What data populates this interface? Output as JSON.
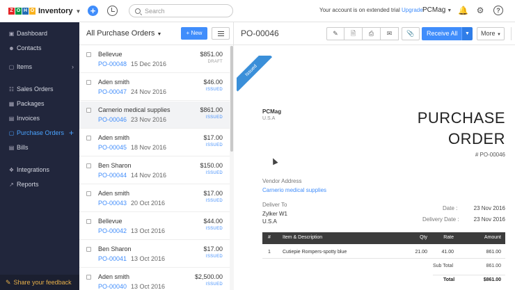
{
  "header": {
    "brand_logo": "ZOHO",
    "brand_name": "Inventory",
    "search_placeholder": "Search",
    "trial_text": "Your account is on extended trial",
    "upgrade_label": "Upgrade",
    "org_name": "PCMag"
  },
  "sidebar": {
    "items": [
      {
        "label": "Dashboard",
        "icon": "dashboard-icon"
      },
      {
        "label": "Contacts",
        "icon": "contacts-icon"
      },
      {
        "label": "Items",
        "icon": "items-icon",
        "chevron": "›"
      },
      {
        "label": "Sales Orders",
        "icon": "sales-orders-icon"
      },
      {
        "label": "Packages",
        "icon": "packages-icon"
      },
      {
        "label": "Invoices",
        "icon": "invoices-icon"
      },
      {
        "label": "Purchase Orders",
        "icon": "purchase-orders-icon",
        "plus": "+"
      },
      {
        "label": "Bills",
        "icon": "bills-icon"
      },
      {
        "label": "Integrations",
        "icon": "integrations-icon"
      },
      {
        "label": "Reports",
        "icon": "reports-icon"
      }
    ],
    "feedback_label": "Share your feedback",
    "accent_color": "#4aa3ff"
  },
  "list": {
    "title": "All Purchase Orders",
    "new_label": "New",
    "rows": [
      {
        "vendor": "Bellevue",
        "po": "PO-00048",
        "date": "15 Dec 2016",
        "amount": "$851.00",
        "status": "DRAFT"
      },
      {
        "vendor": "Aden smith",
        "po": "PO-00047",
        "date": "24 Nov 2016",
        "amount": "$46.00",
        "status": "ISSUED"
      },
      {
        "vendor": "Carnerio medical supplies",
        "po": "PO-00046",
        "date": "23 Nov 2016",
        "amount": "$861.00",
        "status": "ISSUED"
      },
      {
        "vendor": "Aden smith",
        "po": "PO-00045",
        "date": "18 Nov 2016",
        "amount": "$17.00",
        "status": "ISSUED"
      },
      {
        "vendor": "Ben Sharon",
        "po": "PO-00044",
        "date": "14 Nov 2016",
        "amount": "$150.00",
        "status": "ISSUED"
      },
      {
        "vendor": "Aden smith",
        "po": "PO-00043",
        "date": "20 Oct 2016",
        "amount": "$17.00",
        "status": "ISSUED"
      },
      {
        "vendor": "Bellevue",
        "po": "PO-00042",
        "date": "13 Oct 2016",
        "amount": "$44.00",
        "status": "ISSUED"
      },
      {
        "vendor": "Ben Sharon",
        "po": "PO-00041",
        "date": "13 Oct 2016",
        "amount": "$17.00",
        "status": "ISSUED"
      },
      {
        "vendor": "Aden smith",
        "po": "PO-00040",
        "date": "13 Oct 2016",
        "amount": "$2,500.00",
        "status": "ISSUED"
      }
    ]
  },
  "detail": {
    "po_number": "PO-00046",
    "receive_label": "Receive All",
    "more_label": "More",
    "ribbon": "Issued",
    "org_name": "PCMag",
    "org_country": "U.S.A",
    "title_line1": "PURCHASE",
    "title_line2": "ORDER",
    "po_ref": "# PO-00046",
    "vendor_label": "Vendor Address",
    "vendor_name": "Carnerio medical supplies",
    "deliver_label": "Deliver To",
    "deliver_name": "Zylker W1",
    "deliver_country": "U.S.A",
    "date_label": "Date :",
    "date_value": "23 Nov 2016",
    "delivery_date_label": "Delivery Date :",
    "delivery_date_value": "23 Nov 2016",
    "table": {
      "headers": [
        "#",
        "Item & Description",
        "Qty",
        "Rate",
        "Amount"
      ],
      "rows": [
        {
          "num": "1",
          "item": "Cutiepie Rompers-spotty blue",
          "qty": "21.00",
          "rate": "41.00",
          "amount": "861.00"
        }
      ]
    },
    "subtotal_label": "Sub Total",
    "subtotal_value": "861.00",
    "total_label": "Total",
    "total_value": "$861.00"
  }
}
